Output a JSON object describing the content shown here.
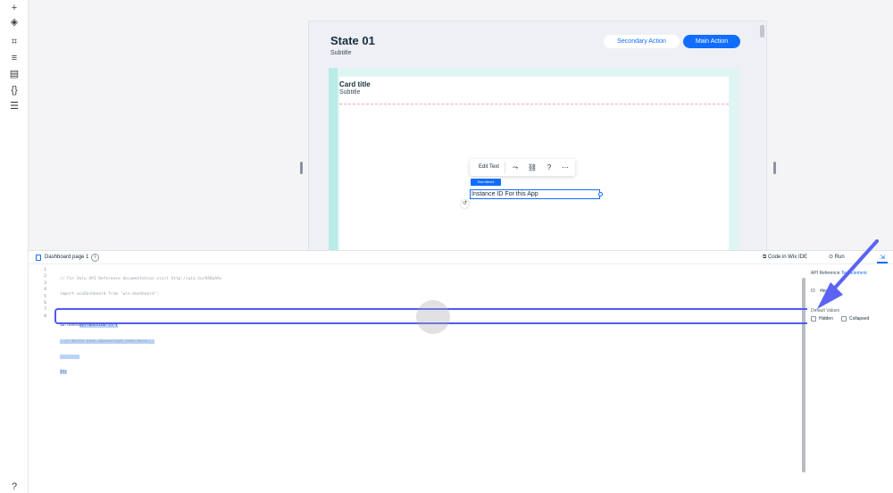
{
  "left_toolbar": {
    "icons": [
      "plus-icon",
      "layers-icon",
      "crop-icon",
      "sliders-icon",
      "table-icon",
      "code-braces-icon",
      "database-icon",
      "help-icon"
    ]
  },
  "page": {
    "title": "State 01",
    "subtitle": "Subtitle",
    "secondary_action": "Secondary Action",
    "main_action": "Main Action"
  },
  "card": {
    "title": "Card title",
    "subtitle": "Subtitle"
  },
  "edit_toolbar": {
    "edit_text": "Edit Text",
    "icons": [
      "connect-icon",
      "link-icon",
      "help-icon",
      "more-icon"
    ]
  },
  "text_element": {
    "tag": "Text #text1",
    "text": "Instance ID For this App"
  },
  "code_panel": {
    "page_tab": "Dashboard page 1",
    "code_in_ide": "Code in Wix IDE",
    "run": "Run",
    "line_numbers": [
      "1",
      "2",
      "3",
      "4",
      "5",
      "6",
      "7",
      "8"
    ],
    "lines": {
      "l1": "// For Velo API Reference documentation visit http://wix.to/94BuAAs",
      "l2": "import wixDashboard from 'wix-dashboard';",
      "l4a": "$w.onRea",
      "l4b": "dy(function () {",
      "l5": "  // Write your Javascript code here...",
      "l7": "});"
    }
  },
  "properties": {
    "api_reference": "API Reference",
    "api_element": "Text Element",
    "id_label": "ID",
    "id_value": "#text1",
    "default_values": "Default Values",
    "hidden": "Hidden",
    "collapsed": "Collapsed"
  },
  "colors": {
    "accent": "#116dff",
    "annotation": "#4f5bf0"
  }
}
